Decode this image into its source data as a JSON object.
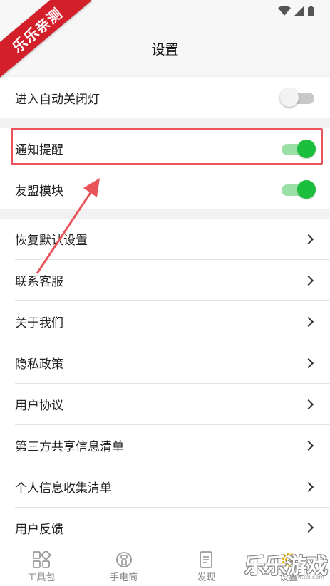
{
  "watermark_ribbon": "乐乐亲测",
  "header": {
    "title": "设置"
  },
  "settings_toggles": [
    {
      "label": "进入自动关闭灯",
      "on": false
    },
    {
      "label": "通知提醒",
      "on": true
    },
    {
      "label": "友盟模块",
      "on": true
    }
  ],
  "settings_links": [
    {
      "label": "恢复默认设置"
    },
    {
      "label": "联系客服"
    },
    {
      "label": "关于我们"
    },
    {
      "label": "隐私政策"
    },
    {
      "label": "用户协议"
    },
    {
      "label": "第三方共享信息清单"
    },
    {
      "label": "个人信息收集清单"
    },
    {
      "label": "用户反馈"
    }
  ],
  "bottom_nav": [
    {
      "label": "工具包",
      "icon": "toolbox-icon"
    },
    {
      "label": "手电筒",
      "icon": "flashlight-icon"
    },
    {
      "label": "发现",
      "icon": "discover-icon"
    },
    {
      "label": "设置",
      "icon": "settings-gear-icon",
      "active": true
    }
  ],
  "watermark": {
    "text": "乐乐游戏",
    "url": "www.dll.com"
  },
  "colors": {
    "toggle_on": "#1bbf3d",
    "toggle_track_on": "#9be0a6",
    "highlight": "#e8545a",
    "ribbon": "#d21f2a"
  }
}
